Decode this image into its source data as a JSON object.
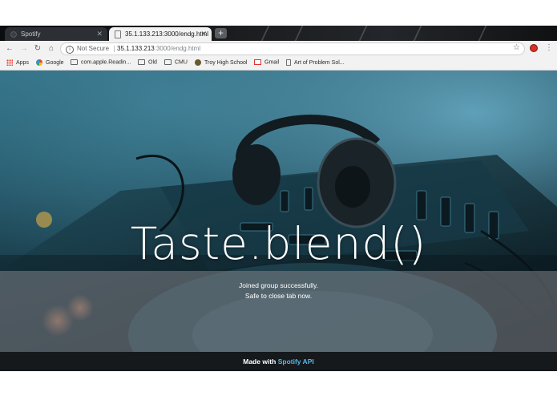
{
  "tabs": [
    {
      "title": "Spotify",
      "active": false
    },
    {
      "title": "35.1.133.213:3000/endg.html",
      "active": true
    }
  ],
  "toolbar": {
    "security_label": "Not Secure",
    "url_host": "35.1.133.213",
    "url_path": ":3000/endg.html"
  },
  "bookmarks": [
    {
      "label": "Apps",
      "icon": "apps-grid-icon"
    },
    {
      "label": "Google",
      "icon": "google-icon"
    },
    {
      "label": "com.apple.Readin...",
      "icon": "folder-icon"
    },
    {
      "label": "Old",
      "icon": "folder-icon"
    },
    {
      "label": "CMU",
      "icon": "folder-icon"
    },
    {
      "label": "Troy High School",
      "icon": "school-icon"
    },
    {
      "label": "Gmail",
      "icon": "gmail-icon"
    },
    {
      "label": "Art of Problem Sol...",
      "icon": "page-icon"
    }
  ],
  "page": {
    "title": "Taste.blend()",
    "message_line1": "Joined group successfully.",
    "message_line2": "Safe to close tab now.",
    "footer_prefix": "Made with ",
    "footer_link": "Spotify API"
  },
  "colors": {
    "footer_link": "#59b7e6",
    "hero_tint": "#1d4756"
  }
}
